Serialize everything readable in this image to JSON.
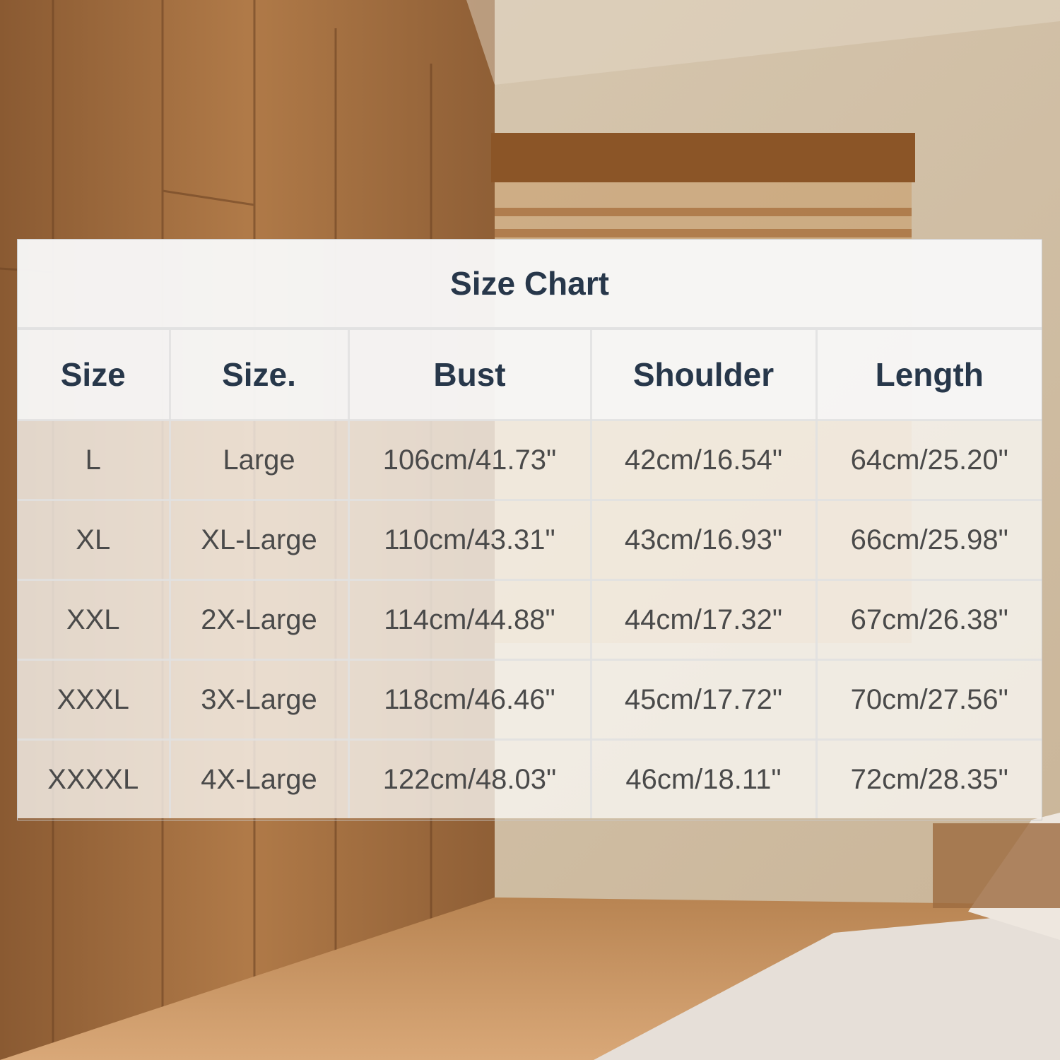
{
  "chart": {
    "title": "Size Chart",
    "headers": [
      "Size",
      "Size.",
      "Bust",
      "Shoulder",
      "Length"
    ],
    "rows": [
      [
        "L",
        "Large",
        "106cm/41.73\"",
        "42cm/16.54\"",
        "64cm/25.20\""
      ],
      [
        "XL",
        "XL-Large",
        "110cm/43.31\"",
        "43cm/16.93\"",
        "66cm/25.98\""
      ],
      [
        "XXL",
        "2X-Large",
        "114cm/44.88\"",
        "44cm/17.32\"",
        "67cm/26.38\""
      ],
      [
        "XXXL",
        "3X-Large",
        "118cm/46.46\"",
        "45cm/17.72\"",
        "70cm/27.56\""
      ],
      [
        "XXXXL",
        "4X-Large",
        "122cm/48.03\"",
        "46cm/18.11\"",
        "72cm/28.35\""
      ]
    ]
  }
}
